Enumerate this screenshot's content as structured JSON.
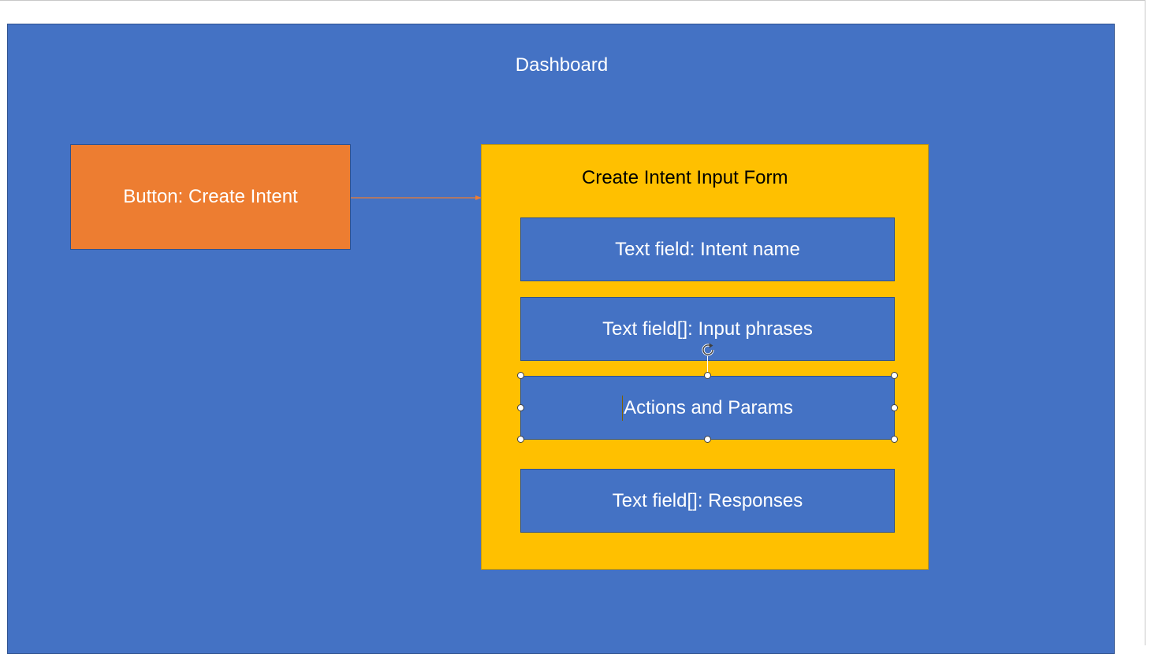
{
  "dashboard": {
    "title": "Dashboard"
  },
  "button_box": {
    "label": "Button: Create Intent"
  },
  "form": {
    "title": "Create Intent Input Form",
    "fields": [
      {
        "label": "Text field: Intent name"
      },
      {
        "label": "Text field[]: Input phrases"
      },
      {
        "label": "Actions and Params"
      },
      {
        "label": "Text field[]: Responses"
      }
    ]
  },
  "colors": {
    "dashboard_fill": "#4472c4",
    "button_fill": "#ed7d31",
    "form_fill": "#ffc000",
    "field_fill": "#4472c4",
    "outline": "#2f528f"
  },
  "selection": {
    "selected_shape": "Actions and Params"
  }
}
